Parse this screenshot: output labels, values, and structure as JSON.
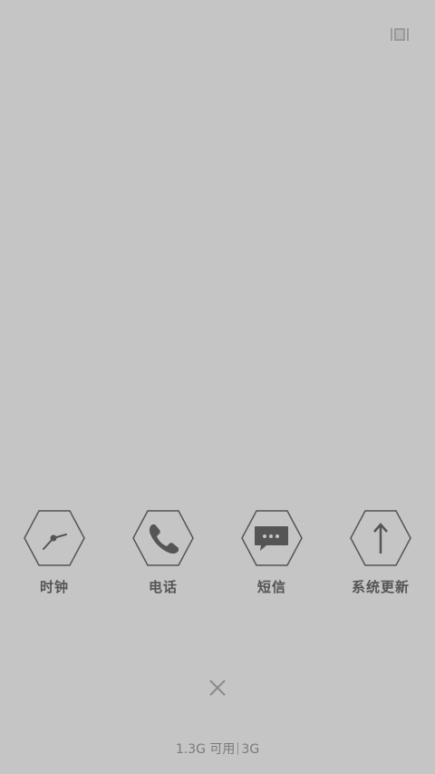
{
  "top_icon": "recent-apps-list-icon",
  "apps": [
    {
      "label": "时钟",
      "icon": "clock-icon"
    },
    {
      "label": "电话",
      "icon": "phone-icon"
    },
    {
      "label": "短信",
      "icon": "message-icon"
    },
    {
      "label": "系统更新",
      "icon": "arrow-up-icon"
    }
  ],
  "close_icon": "close-icon",
  "memory": {
    "available": "1.3G 可用",
    "total": "3G"
  },
  "colors": {
    "background": "#c5c5c5",
    "icon": "#555555",
    "label": "#555555",
    "footer_text": "#7a7a7a"
  }
}
